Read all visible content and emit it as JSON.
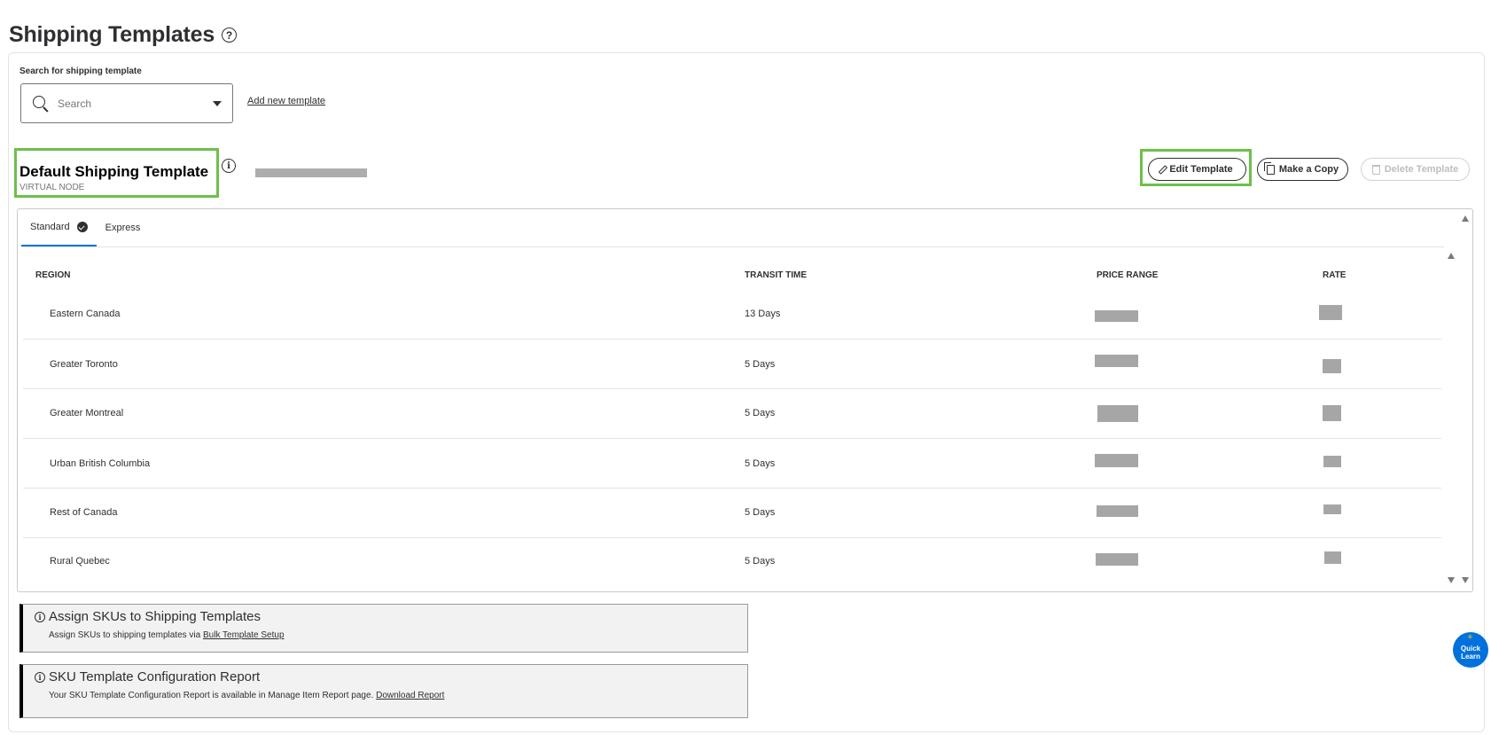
{
  "page": {
    "title": "Shipping Templates"
  },
  "search": {
    "label": "Search for shipping template",
    "placeholder": "Search",
    "add_link": "Add new template"
  },
  "template": {
    "title": "Default Shipping Template",
    "subtitle": "VIRTUAL NODE"
  },
  "actions": {
    "edit": "Edit Template",
    "copy": "Make a Copy",
    "delete": "Delete Template"
  },
  "tabs": [
    {
      "label": "Standard",
      "active": true,
      "verified": true
    },
    {
      "label": "Express",
      "active": false
    }
  ],
  "table": {
    "headers": {
      "region": "REGION",
      "transit": "TRANSIT TIME",
      "price": "PRICE RANGE",
      "rate": "RATE"
    },
    "rows": [
      {
        "region": "Eastern Canada",
        "transit": "13 Days"
      },
      {
        "region": "Greater Toronto",
        "transit": "5 Days"
      },
      {
        "region": "Greater Montreal",
        "transit": "5 Days"
      },
      {
        "region": "Urban British Columbia",
        "transit": "5 Days"
      },
      {
        "region": "Rest of Canada",
        "transit": "5 Days"
      },
      {
        "region": "Rural Quebec",
        "transit": "5 Days"
      }
    ]
  },
  "notices": [
    {
      "title": "Assign SKUs to Shipping Templates",
      "body": "Assign SKUs to shipping templates via ",
      "link": "Bulk Template Setup"
    },
    {
      "title": "SKU Template Configuration Report",
      "body": "Your SKU Template Configuration Report is available in Manage Item Report page. ",
      "link": "Download Report"
    }
  ],
  "quick_learn": {
    "line1": "Quick",
    "line2": "Learn"
  },
  "colors": {
    "accent": "#0071dc",
    "highlight": "#6cc04a",
    "redacted": "#a6a6a6"
  }
}
